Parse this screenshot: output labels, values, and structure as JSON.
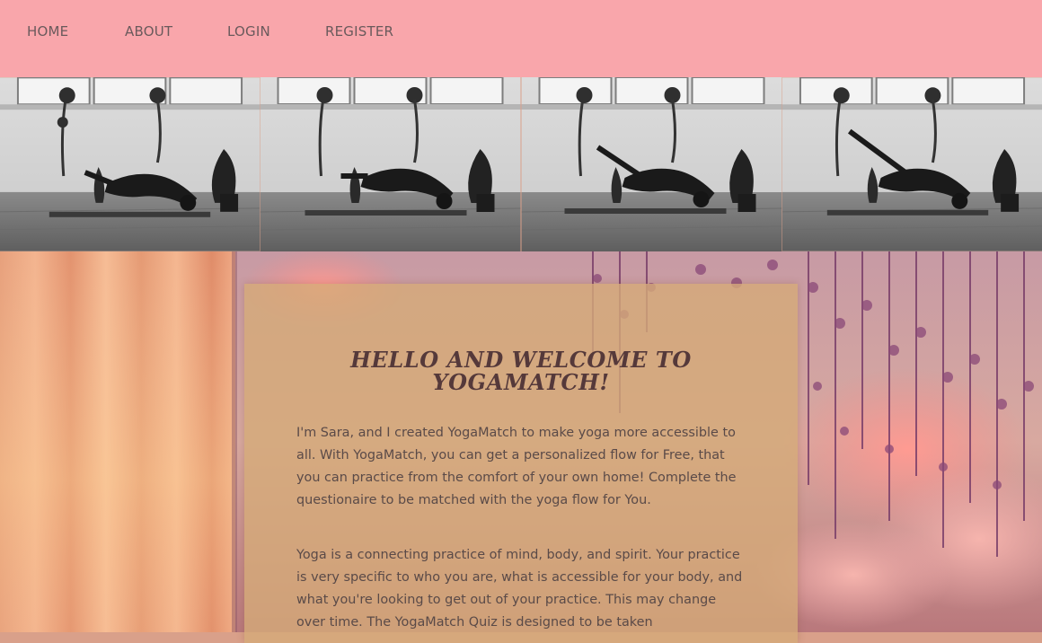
{
  "nav": {
    "items": [
      {
        "label": "HOME"
      },
      {
        "label": "ABOUT"
      },
      {
        "label": "LOGIN"
      },
      {
        "label": "REGISTER"
      }
    ]
  },
  "gallery": {
    "photos": [
      {
        "description_icon": "yoga-pose-photo"
      },
      {
        "description_icon": "yoga-pose-photo"
      },
      {
        "description_icon": "yoga-pose-photo"
      },
      {
        "description_icon": "yoga-pose-photo"
      }
    ]
  },
  "welcome": {
    "title": "Hello and welcome to YogaMatch!",
    "paragraph1": "I'm Sara, and I created YogaMatch to make yoga more accessible to all. With YogaMatch, you can get a personalized flow for Free, that you can practice from the comfort of your own home! Complete the questionaire to be matched with the yoga flow for You.",
    "paragraph2": "Yoga is a connecting practice of mind, body, and spirit. Your practice is very specific to who you are, what is accessible for your body, and what you're looking to get out of your practice. This may change over time. The YogaMatch Quiz is designed to be taken"
  },
  "colors": {
    "nav_bg": "#f9a6ab",
    "nav_text": "#6a5a5c",
    "card_bg": "#d5aa78",
    "title_text": "#55393a",
    "body_text": "#5a4a48"
  }
}
